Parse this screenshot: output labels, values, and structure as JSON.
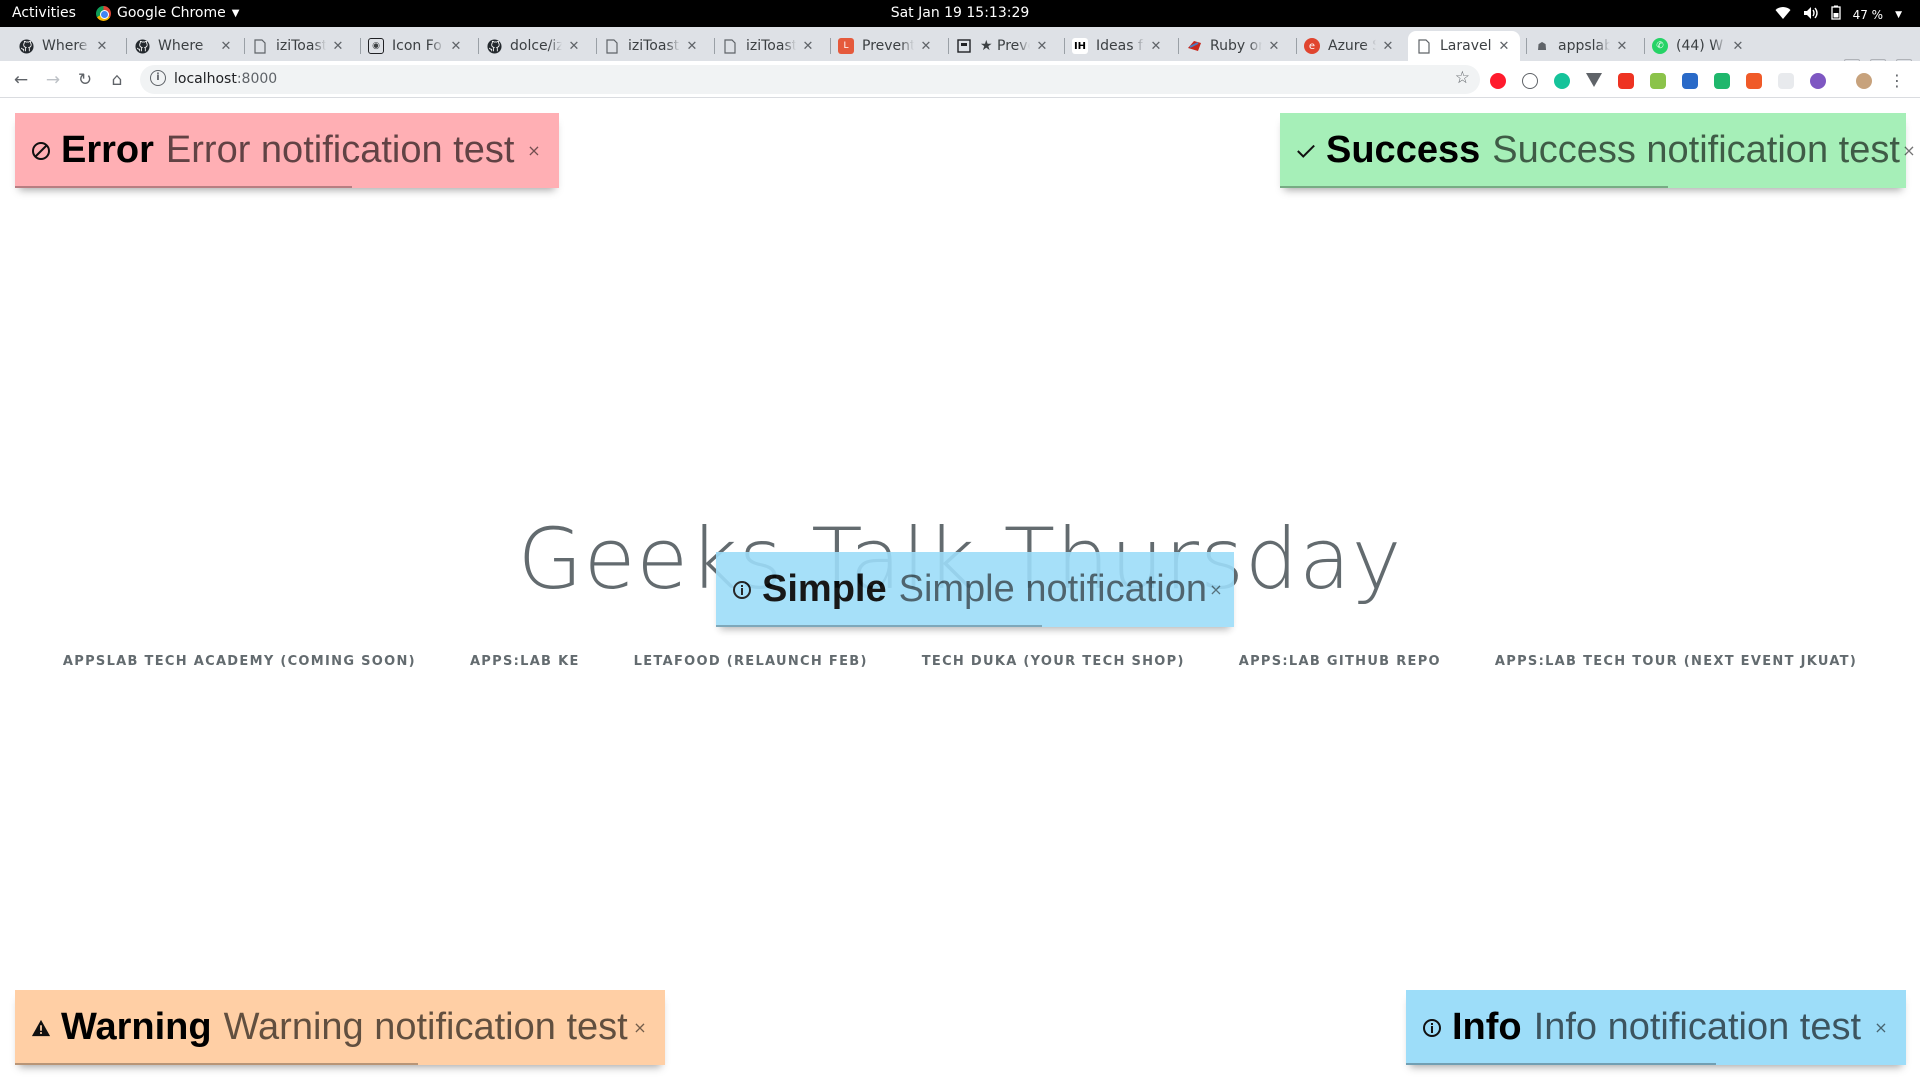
{
  "topbar": {
    "activities": "Activities",
    "app_name": "Google Chrome",
    "clock": "Sat Jan 19  15:13:29",
    "battery": "47 %"
  },
  "tabs": [
    {
      "title": "Where",
      "icon": "github-icon"
    },
    {
      "title": "Where",
      "icon": "github-icon"
    },
    {
      "title": "iziToast",
      "icon": "page-icon"
    },
    {
      "title": "Icon Fo",
      "icon": "iconfont-icon"
    },
    {
      "title": "dolce/iz",
      "icon": "github-icon"
    },
    {
      "title": "iziToast",
      "icon": "page-icon"
    },
    {
      "title": "iziToast",
      "icon": "page-icon"
    },
    {
      "title": "Prevent",
      "icon": "laracasts-icon"
    },
    {
      "title": "★ Preve",
      "icon": "bookmark-page-icon"
    },
    {
      "title": "Ideas fo",
      "icon": "ih-icon"
    },
    {
      "title": "Ruby or",
      "icon": "ruby-icon"
    },
    {
      "title": "Azure S",
      "icon": "azure-icon"
    },
    {
      "title": "Laravel",
      "icon": "page-icon",
      "active": true
    },
    {
      "title": "appslab",
      "icon": "appslab-icon"
    },
    {
      "title": "(44) W",
      "icon": "whatsapp-icon"
    }
  ],
  "address": {
    "host": "localhost",
    "port": ":8000"
  },
  "page": {
    "title": "Geeks Talk Thursday",
    "links": [
      "AppsLab Tech Academy (Coming Soon)",
      "Apps:Lab KE",
      "LetaFood (Relaunch Feb)",
      "Tech Duka (Your Tech Shop)",
      "Apps:Lab GitHub Repo",
      "Apps:Lab Tech Tour (Next Event JKUAT)"
    ]
  },
  "toasts": {
    "error": {
      "title": "Error",
      "message": "Error notification test",
      "progress": 0.62
    },
    "success": {
      "title": "Success",
      "message": "Success notification test",
      "progress": 0.62
    },
    "simple": {
      "title": "Simple",
      "message": "Simple notification",
      "progress": 0.63
    },
    "warning": {
      "title": "Warning",
      "message": "Warning notification test",
      "progress": 0.62
    },
    "info": {
      "title": "Info",
      "message": "Info notification test",
      "progress": 0.62
    },
    "close_glyph": "×"
  },
  "colors": {
    "error_bg": "#ffafb4",
    "success_bg": "#a6efb8",
    "info_bg": "#9dddf9",
    "warning_bg": "#ffcfa5",
    "page_text": "#636b6f"
  }
}
